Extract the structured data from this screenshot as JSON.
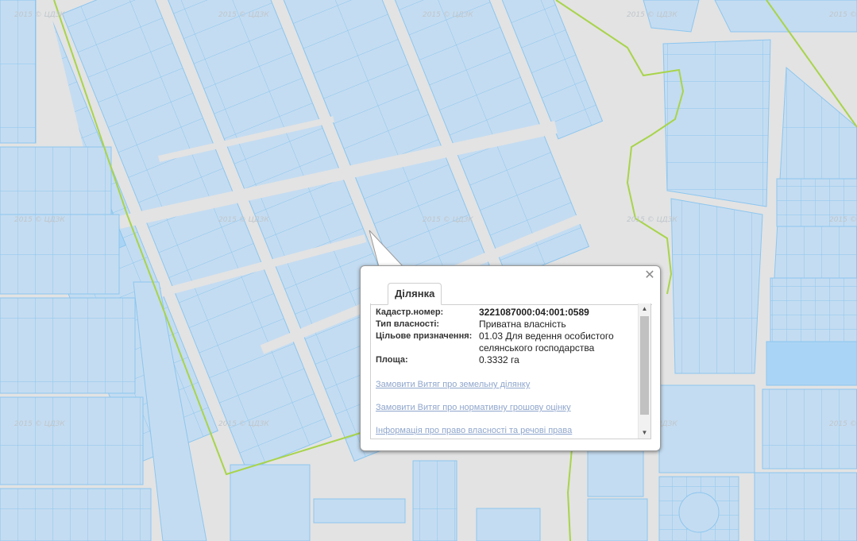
{
  "map": {
    "watermark": "2015 © ЦДЗК",
    "colors": {
      "background": "#e3e3e3",
      "parcel_fill": "#c4dcf1",
      "parcel_stroke": "#8cc6ef",
      "highlight_fill": "#aad4f5",
      "boundary_line": "#a8d44a"
    }
  },
  "popup": {
    "close_icon": "close-icon",
    "tab_label": "Ділянка",
    "fields": [
      {
        "key": "Кадастр.номер:",
        "value": "3221087000:04:001:0589"
      },
      {
        "key": "Тип власності:",
        "value": "Приватна власність"
      },
      {
        "key": "Цільове призначення:",
        "value": "01.03 Для ведення особистого селянського господарства"
      },
      {
        "key": "Площа:",
        "value": "0.3332 га"
      }
    ],
    "links": [
      "Замовити Витяг про земельну ділянку",
      "Замовити Витяг про нормативну грошову оцінку",
      "Інформація про право власності та речові права"
    ]
  }
}
